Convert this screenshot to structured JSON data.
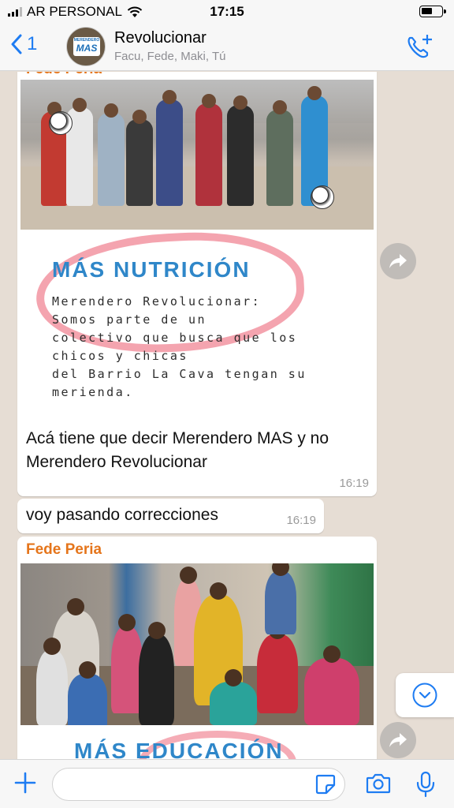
{
  "status_bar": {
    "carrier": "AR PERSONAL",
    "time": "17:15"
  },
  "header": {
    "back_count": "1",
    "avatar_small_text": "MERENDERO",
    "avatar_big_text": "MAS",
    "title": "Revolucionar",
    "members": "Facu, Fede, Maki, Tú"
  },
  "messages": [
    {
      "sender": "Fede Peria",
      "image_headline": "MÁS NUTRICIÓN",
      "image_text": "Merendero Revolucionar:\nSomos parte de un\ncolectivo que busca que los\nchicos y chicas\ndel Barrio La Cava tengan su\nmerienda.",
      "text": "Acá tiene que decir Merendero MAS y no Merendero Revolucionar",
      "time": "16:19"
    },
    {
      "text": "voy pasando correcciones",
      "time": "16:19"
    },
    {
      "sender": "Fede Peria",
      "image_headline": "MÁS EDUCACIÓN"
    }
  ],
  "input": {
    "placeholder": ""
  },
  "colors": {
    "accent": "#1e7cf2",
    "sender": "#e5751b",
    "chat_bg": "#e6ddd4",
    "headline_blue": "#2f87c9"
  },
  "icons": [
    "signal-bars-icon",
    "wifi-icon",
    "battery-icon",
    "chevron-left-icon",
    "add-call-icon",
    "forward-icon",
    "chevron-down-icon",
    "plus-icon",
    "sticker-icon",
    "camera-icon",
    "microphone-icon"
  ]
}
